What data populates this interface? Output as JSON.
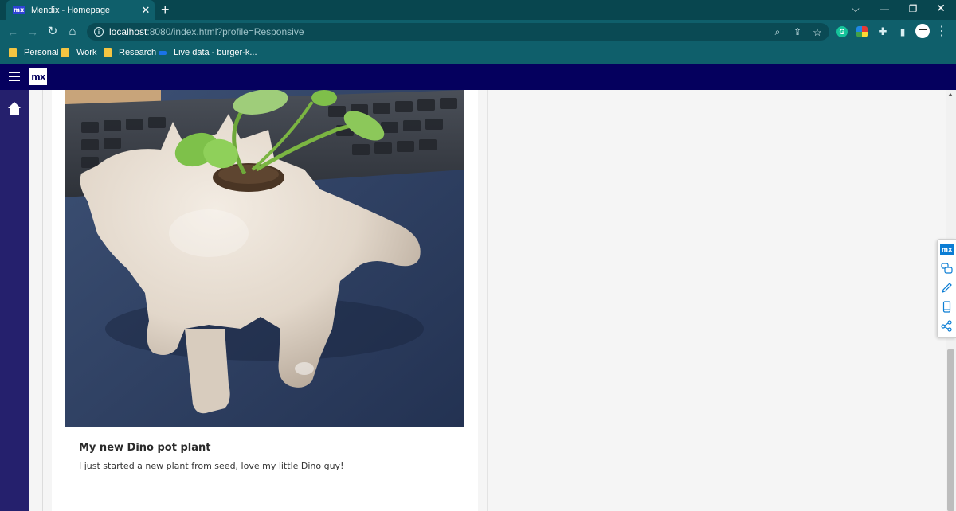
{
  "browser": {
    "tab": {
      "favicon_text": "mx",
      "title": "Mendix - Homepage",
      "close_glyph": "✕"
    },
    "new_tab_glyph": "+",
    "window_controls": {
      "dropdown": "⌵",
      "minimize": "—",
      "restore": "❐",
      "close": "✕"
    },
    "nav": {
      "back": "←",
      "forward": "→",
      "reload": "↻",
      "home": "⌂"
    },
    "address": {
      "host": "localhost",
      "path": ":8080/index.html?profile=Responsive"
    },
    "omnibox_icons": {
      "zoom": "⌕",
      "share": "⇪",
      "bookmark": "☆"
    },
    "extensions": {
      "grammarly": "G",
      "puzzle": "✚",
      "sidepanel": "▮",
      "menu": "⋮"
    },
    "bookmarks": [
      {
        "label": "Personal",
        "icon": "folder-icon"
      },
      {
        "label": "Work",
        "icon": "folder-icon"
      },
      {
        "label": "Research",
        "icon": "folder-icon"
      },
      {
        "label": "Live data - burger-k...",
        "icon": "live-data-favicon"
      }
    ]
  },
  "app": {
    "logo_text": "mx",
    "brand_color": "#05005e",
    "sidebar_color": "#25206d",
    "post": {
      "title": "My new Dino pot plant",
      "text": "I just started a new plant from seed, love my little Dino guy!"
    },
    "devbar": {
      "logo_text": "mx"
    }
  }
}
